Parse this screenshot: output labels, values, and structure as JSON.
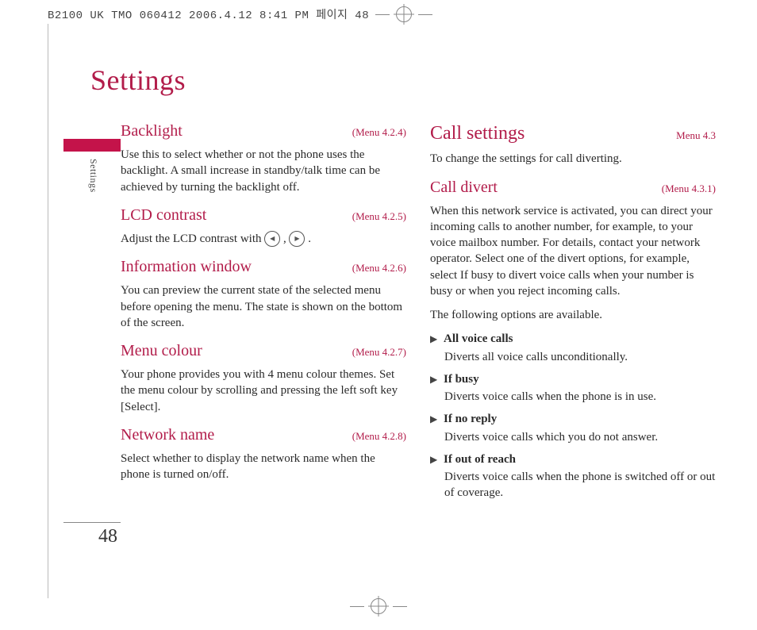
{
  "print_header": "B2100 UK TMO 060412  2006.4.12 8:41 PM  페이지 48",
  "page_title": "Settings",
  "side_label": "Settings",
  "page_number": "48",
  "left": {
    "backlight": {
      "title": "Backlight",
      "ref": "(Menu 4.2.4)",
      "body": "Use this to select whether or not the phone uses the backlight. A small increase in standby/talk time can be achieved by turning the backlight off."
    },
    "lcd": {
      "title": "LCD contrast",
      "ref": "(Menu 4.2.5)",
      "body_pre": "Adjust the LCD contrast with ",
      "body_post": " ."
    },
    "info": {
      "title": "Information window",
      "ref": "(Menu 4.2.6)",
      "body": "You can preview the current state of the selected menu before opening the menu. The state is shown on the bottom of the screen."
    },
    "menucolour": {
      "title": "Menu colour",
      "ref": "(Menu 4.2.7)",
      "body": "Your phone provides you with 4 menu colour themes. Set the menu colour by scrolling and pressing the left soft key [Select]."
    },
    "network": {
      "title": "Network name",
      "ref": "(Menu 4.2.8)",
      "body": "Select whether to display the network name when the phone is turned on/off."
    }
  },
  "right": {
    "callsettings": {
      "title": "Call settings",
      "ref": "Menu 4.3",
      "body": "To change the settings for call diverting."
    },
    "calldivert": {
      "title": "Call divert",
      "ref": "(Menu 4.3.1)",
      "body1": "When this network service is activated, you can direct your incoming calls to another number, for example, to your voice mailbox number. For details, contact your network operator. Select one of the divert options, for example, select If busy to divert voice calls when your number is busy or when you reject incoming calls.",
      "body2": "The following options are available.",
      "options": [
        {
          "label": "All voice calls",
          "desc": "Diverts all voice calls unconditionally."
        },
        {
          "label": "If busy",
          "desc": "Diverts voice calls when the phone is in use."
        },
        {
          "label": "If no reply",
          "desc": "Diverts voice calls which you do not answer."
        },
        {
          "label": "If out of reach",
          "desc": "Diverts voice calls when the phone is switched off or out of coverage."
        }
      ]
    }
  }
}
